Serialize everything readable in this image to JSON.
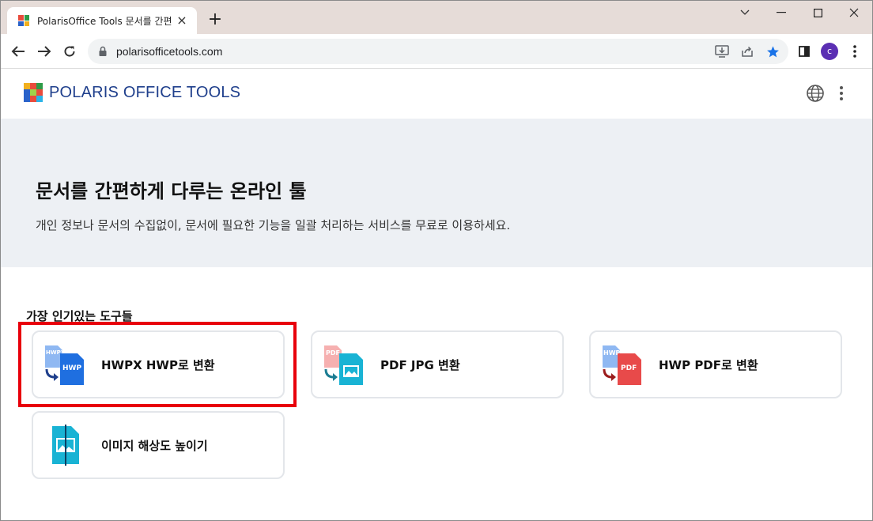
{
  "browser": {
    "tab_title": "PolarisOffice Tools 문서를 간편하",
    "tab_close": "×",
    "new_tab": "+",
    "url": "polarisofficetools.com",
    "profile_initial": "c"
  },
  "site": {
    "logo_bold": "POLARIS",
    "logo_light": " OFFICE TOOLS"
  },
  "hero": {
    "title": "문서를 간편하게 다루는 온라인 툴",
    "subtitle": "개인 정보나 문서의 수집없이, 문서에 필요한 기능을 일괄 처리하는 서비스를 무료로 이용하세요."
  },
  "tools": {
    "section_title": "가장 인기있는 도구들",
    "items": [
      {
        "label": "HWPX HWP로 변환",
        "icon": "hwpx-to-hwp-icon",
        "icon_back": "HWPX",
        "icon_front": "HWP"
      },
      {
        "label": "PDF JPG 변환",
        "icon": "pdf-to-jpg-icon",
        "icon_back": "PDF"
      },
      {
        "label": "HWP PDF로 변환",
        "icon": "hwp-to-pdf-icon",
        "icon_back": "HWP",
        "icon_front": "PDF"
      },
      {
        "label": "이미지 해상도 높이기",
        "icon": "image-upscale-icon"
      }
    ]
  },
  "colors": {
    "tab_strip": "#e6dcd8",
    "hero_bg": "#edf0f4",
    "logo_text": "#1f3f8c",
    "highlight": "#e8000b",
    "hwp_blue": "#1f6fe0",
    "pdf_red": "#e84a4a",
    "jpg_cyan": "#19b3d4"
  }
}
